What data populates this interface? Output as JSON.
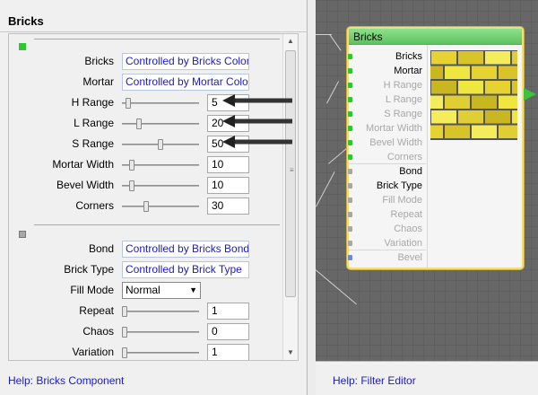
{
  "left_panel": {
    "title": "Bricks",
    "help_link": "Help: Bricks Component",
    "section1_color": "#2dc82d",
    "section2_color": "#a8a8a8",
    "rows_top": [
      {
        "label": "Bricks",
        "kind": "link",
        "value": "Controlled by Bricks Color"
      },
      {
        "label": "Mortar",
        "kind": "link",
        "value": "Controlled by Mortar Color"
      },
      {
        "label": "H Range",
        "kind": "slider",
        "value": "5",
        "level": 0.05
      },
      {
        "label": "L Range",
        "kind": "slider",
        "value": "20",
        "level": 0.2
      },
      {
        "label": "S Range",
        "kind": "slider",
        "value": "50",
        "level": 0.5
      },
      {
        "label": "Mortar Width",
        "kind": "slider",
        "value": "10",
        "level": 0.1
      },
      {
        "label": "Bevel Width",
        "kind": "slider",
        "value": "10",
        "level": 0.1
      },
      {
        "label": "Corners",
        "kind": "slider",
        "value": "30",
        "level": 0.3
      }
    ],
    "rows_bottom": [
      {
        "label": "Bond",
        "kind": "link",
        "value": "Controlled by Bricks Bond"
      },
      {
        "label": "Brick Type",
        "kind": "link",
        "value": "Controlled by Brick Type"
      },
      {
        "label": "Fill Mode",
        "kind": "select",
        "value": "Normal"
      },
      {
        "label": "Repeat",
        "kind": "slider",
        "value": "1",
        "level": 0.0
      },
      {
        "label": "Chaos",
        "kind": "slider",
        "value": "0",
        "level": 0.0
      },
      {
        "label": "Variation",
        "kind": "slider",
        "value": "1",
        "level": 0.0
      }
    ]
  },
  "right_panel": {
    "help_link": "Help: Filter Editor",
    "node": {
      "title": "Bricks",
      "title_color": "#6fcf6f",
      "ports": [
        {
          "label": "Bricks",
          "active": true,
          "dot": "#2dc82d"
        },
        {
          "label": "Mortar",
          "active": true,
          "dot": "#2dc82d"
        },
        {
          "label": "H Range",
          "active": false,
          "dot": "#2dc82d"
        },
        {
          "label": "L Range",
          "active": false,
          "dot": "#2dc82d"
        },
        {
          "label": "S Range",
          "active": false,
          "dot": "#2dc82d"
        },
        {
          "label": "Mortar Width",
          "active": false,
          "dot": "#2dc82d"
        },
        {
          "label": "Bevel Width",
          "active": false,
          "dot": "#2dc82d"
        },
        {
          "label": "Corners",
          "active": false,
          "dot": "#2dc82d"
        },
        {
          "label": "Bond",
          "active": true,
          "dot": "#a8a8a8"
        },
        {
          "label": "Brick Type",
          "active": true,
          "dot": "#a8a8a8"
        },
        {
          "label": "Fill Mode",
          "active": false,
          "dot": "#a8a8a8"
        },
        {
          "label": "Repeat",
          "active": false,
          "dot": "#a8a8a8"
        },
        {
          "label": "Chaos",
          "active": false,
          "dot": "#a8a8a8"
        },
        {
          "label": "Variation",
          "active": false,
          "dot": "#a8a8a8"
        },
        {
          "label": "Bevel",
          "active": false,
          "dot": "#6b8bd8"
        }
      ]
    }
  }
}
